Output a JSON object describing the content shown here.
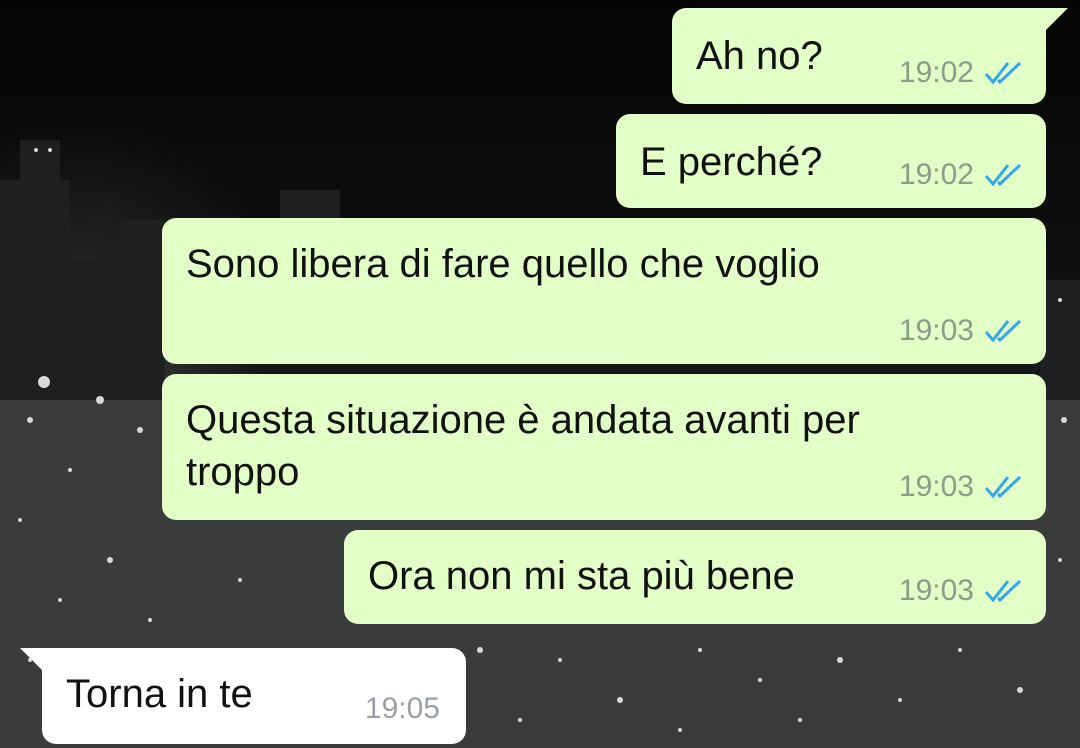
{
  "colors": {
    "outgoing_bubble": "#e1ffc7",
    "incoming_bubble": "#ffffff",
    "read_ticks": "#35a6e8",
    "timestamp": "#8e9a8a"
  },
  "messages": [
    {
      "direction": "outgoing",
      "text": "Ah no?",
      "time": "19:02",
      "status_icon": "double-check-read-icon"
    },
    {
      "direction": "outgoing",
      "text": "E perché?",
      "time": "19:02",
      "status_icon": "double-check-read-icon"
    },
    {
      "direction": "outgoing",
      "text": "Sono libera di fare quello che voglio",
      "time": "19:03",
      "status_icon": "double-check-read-icon"
    },
    {
      "direction": "outgoing",
      "text": "Questa situazione è andata avanti per\ntroppo",
      "time": "19:03",
      "status_icon": "double-check-read-icon"
    },
    {
      "direction": "outgoing",
      "text": "Ora non mi sta più bene",
      "time": "19:03",
      "status_icon": "double-check-read-icon"
    },
    {
      "direction": "incoming",
      "text": "Torna in te",
      "time": "19:05"
    }
  ]
}
